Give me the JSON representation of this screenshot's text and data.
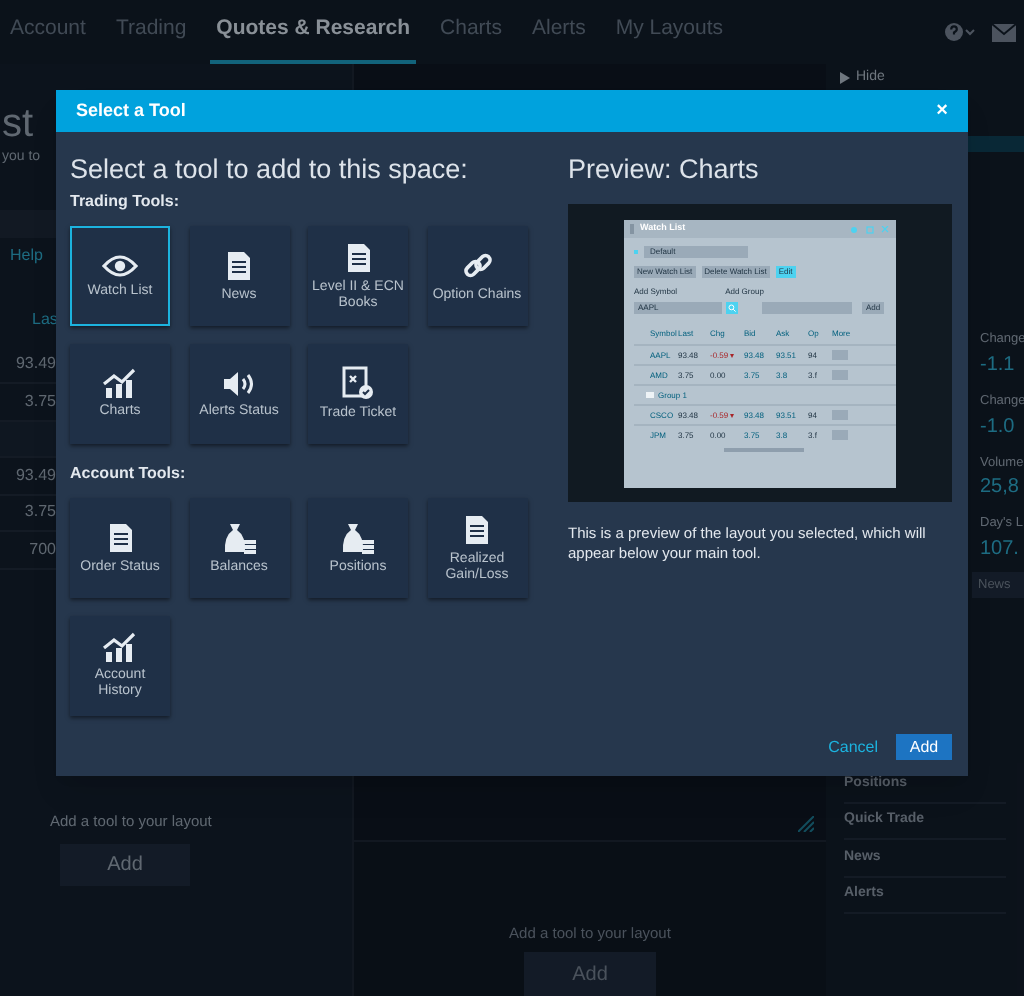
{
  "nav": {
    "tabs": [
      {
        "label": "Account",
        "selected": false
      },
      {
        "label": "Trading",
        "selected": false
      },
      {
        "label": "Quotes & Research",
        "selected": true
      },
      {
        "label": "Charts",
        "selected": false
      },
      {
        "label": "Alerts",
        "selected": false
      },
      {
        "label": "My Layouts",
        "selected": false
      }
    ]
  },
  "left_panel": {
    "title": "st",
    "subtitle": "you to",
    "help": "Help",
    "column": "Las",
    "rows": [
      {
        "kind": "value",
        "value": "93.49"
      },
      {
        "kind": "value",
        "value": "3.75"
      },
      {
        "kind": "group"
      },
      {
        "kind": "value",
        "value": "93.49"
      },
      {
        "kind": "value",
        "value": "3.75"
      },
      {
        "kind": "value",
        "value": "700"
      }
    ]
  },
  "right_panel": {
    "hide": "Hide",
    "quotes": [
      {
        "label": "Change",
        "value": "-1.1"
      },
      {
        "label": "Change",
        "value": "-1.0"
      },
      {
        "label": "Volume",
        "value": "25,8"
      },
      {
        "label": "Day's L",
        "value": "107."
      }
    ],
    "tab": "News",
    "items": [
      "Positions",
      "Quick Trade",
      "News",
      "Alerts"
    ]
  },
  "bottom_panels": [
    {
      "text": "Add a tool to your layout",
      "button": "Add"
    },
    {
      "text": "Add a tool to your layout",
      "button": "Add"
    }
  ],
  "modal": {
    "title": "Select a Tool",
    "close": "×",
    "heading": "Select a tool to add to this space:",
    "sections": [
      {
        "title": "Trading Tools:",
        "tools": [
          {
            "label": "Watch List",
            "kind": "eye",
            "selected": true
          },
          {
            "label": "News",
            "kind": "document",
            "selected": false
          },
          {
            "label": "Level II & ECN Books",
            "kind": "document",
            "selected": false
          },
          {
            "label": "Option Chains",
            "kind": "link",
            "selected": false
          },
          {
            "label": "Charts",
            "kind": "chart",
            "selected": false
          },
          {
            "label": "Alerts Status",
            "kind": "speaker",
            "selected": false
          },
          {
            "label": "Trade Ticket",
            "kind": "ticket",
            "selected": false
          }
        ]
      },
      {
        "title": "Account Tools:",
        "tools": [
          {
            "label": "Order Status",
            "kind": "document",
            "selected": false
          },
          {
            "label": "Balances",
            "kind": "moneybag",
            "selected": false
          },
          {
            "label": "Positions",
            "kind": "moneybag",
            "selected": false
          },
          {
            "label": "Realized Gain/Loss",
            "kind": "document",
            "selected": false
          },
          {
            "label": "Account History",
            "kind": "chart",
            "selected": false
          }
        ]
      }
    ],
    "preview": {
      "title": "Preview: Charts",
      "description": "This is a preview of the layout you selected, which will appear below your main tool.",
      "window": {
        "title": "Watch List",
        "dropdown": "Default",
        "buttons": [
          "New Watch List",
          "Delete Watch List",
          "Edit"
        ],
        "add_symbol_label": "Add Symbol",
        "add_group_label": "Add Group",
        "symbol": "AAPL",
        "add_button": "Add",
        "columns": [
          "Symbol",
          "Last",
          "Chg",
          "Bid",
          "Ask",
          "Op",
          "More"
        ],
        "rows": [
          {
            "kind": "quote",
            "down": true,
            "cells": [
              "AAPL",
              "93.48",
              "-0.59 ▾",
              "93.48",
              "93.51",
              "94"
            ]
          },
          {
            "kind": "quote",
            "down": false,
            "cells": [
              "AMD",
              "3.75",
              "0.00",
              "3.75",
              "3.8",
              "3.f"
            ]
          },
          {
            "kind": "group",
            "label": "Group 1"
          },
          {
            "kind": "quote",
            "down": true,
            "cells": [
              "CSCO",
              "93.48",
              "-0.59 ▾",
              "93.48",
              "93.51",
              "94"
            ]
          },
          {
            "kind": "quote",
            "down": false,
            "cells": [
              "JPM",
              "3.75",
              "0.00",
              "3.75",
              "3.8",
              "3.f"
            ]
          }
        ]
      }
    },
    "cancel": "Cancel",
    "add": "Add"
  }
}
